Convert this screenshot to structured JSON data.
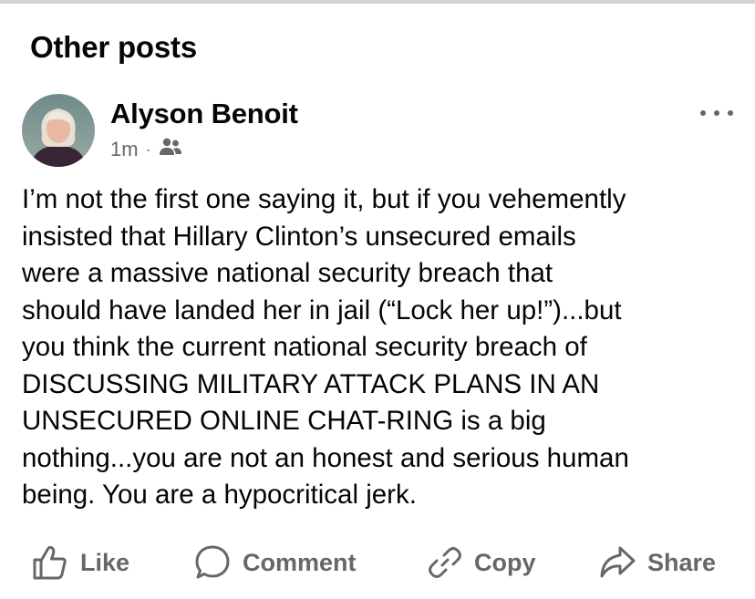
{
  "section": {
    "title": "Other posts"
  },
  "post": {
    "author": "Alyson Benoit",
    "time": "1m",
    "separator": "·",
    "audience_icon": "friends-icon",
    "text": "I’m not the first one saying it, but if you vehemently\ninsisted that Hillary Clinton’s unsecured emails\nwere a massive national security breach that\nshould have landed her in jail (“Lock her up!”)...but\nyou think the current national security breach of\nDISCUSSING MILITARY ATTACK PLANS IN AN\nUNSECURED ONLINE CHAT-RING is a big\nnothing...you are not an honest and serious human\nbeing. You are a hypocritical jerk."
  },
  "actions": {
    "like": "Like",
    "comment": "Comment",
    "copy": "Copy",
    "share": "Share"
  },
  "colors": {
    "text": "#050505",
    "secondary": "#65676b",
    "divider": "#cfd3d9"
  }
}
